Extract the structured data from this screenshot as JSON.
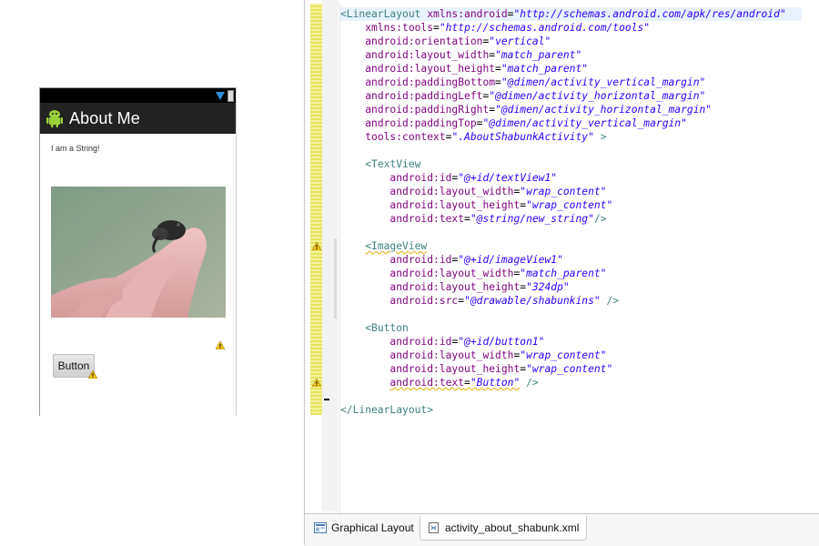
{
  "device": {
    "app_title": "About Me",
    "text_view": "I am a String!",
    "button_label": "Button",
    "icons": [
      "android-icon",
      "wifi-icon",
      "battery-icon",
      "warning-icon"
    ]
  },
  "editor": {
    "lines": [
      {
        "indent": "",
        "parts": [
          [
            "tag",
            "<LinearLayout "
          ],
          [
            "attr",
            "xmlns:android"
          ],
          [
            "eq",
            "="
          ],
          [
            "val",
            "\"http://schemas.android.com/apk/res/android\""
          ]
        ]
      },
      {
        "indent": "    ",
        "parts": [
          [
            "attr",
            "xmlns:tools"
          ],
          [
            "eq",
            "="
          ],
          [
            "val",
            "\"http://schemas.android.com/tools\""
          ]
        ]
      },
      {
        "indent": "    ",
        "parts": [
          [
            "attr",
            "android:orientation"
          ],
          [
            "eq",
            "="
          ],
          [
            "val",
            "\"vertical\""
          ]
        ]
      },
      {
        "indent": "    ",
        "parts": [
          [
            "attr",
            "android:layout_width"
          ],
          [
            "eq",
            "="
          ],
          [
            "val",
            "\"match_parent\""
          ]
        ]
      },
      {
        "indent": "    ",
        "parts": [
          [
            "attr",
            "android:layout_height"
          ],
          [
            "eq",
            "="
          ],
          [
            "val",
            "\"match_parent\""
          ]
        ]
      },
      {
        "indent": "    ",
        "parts": [
          [
            "attr",
            "android:paddingBottom"
          ],
          [
            "eq",
            "="
          ],
          [
            "val",
            "\"@dimen/activity_vertical_margin\""
          ]
        ]
      },
      {
        "indent": "    ",
        "parts": [
          [
            "attr",
            "android:paddingLeft"
          ],
          [
            "eq",
            "="
          ],
          [
            "val",
            "\"@dimen/activity_horizontal_margin\""
          ]
        ]
      },
      {
        "indent": "    ",
        "parts": [
          [
            "attr",
            "android:paddingRight"
          ],
          [
            "eq",
            "="
          ],
          [
            "val",
            "\"@dimen/activity_horizontal_margin\""
          ]
        ]
      },
      {
        "indent": "    ",
        "parts": [
          [
            "attr",
            "android:paddingTop"
          ],
          [
            "eq",
            "="
          ],
          [
            "val",
            "\"@dimen/activity_vertical_margin\""
          ]
        ]
      },
      {
        "indent": "    ",
        "parts": [
          [
            "attr",
            "tools:context"
          ],
          [
            "eq",
            "="
          ],
          [
            "val",
            "\".AboutShabunkActivity\""
          ],
          [
            "tag",
            " >"
          ]
        ]
      },
      {
        "indent": "",
        "parts": []
      },
      {
        "indent": "    ",
        "parts": [
          [
            "tag",
            "<TextView"
          ]
        ]
      },
      {
        "indent": "        ",
        "parts": [
          [
            "attr",
            "android:id"
          ],
          [
            "eq",
            "="
          ],
          [
            "val",
            "\"@+id/textView1\""
          ]
        ]
      },
      {
        "indent": "        ",
        "parts": [
          [
            "attr",
            "android:layout_width"
          ],
          [
            "eq",
            "="
          ],
          [
            "val",
            "\"wrap_content\""
          ]
        ]
      },
      {
        "indent": "        ",
        "parts": [
          [
            "attr",
            "android:layout_height"
          ],
          [
            "eq",
            "="
          ],
          [
            "val",
            "\"wrap_content\""
          ]
        ]
      },
      {
        "indent": "        ",
        "parts": [
          [
            "attr",
            "android:text"
          ],
          [
            "eq",
            "="
          ],
          [
            "val",
            "\"@string/new_string\""
          ],
          [
            "tag",
            "/>"
          ]
        ]
      },
      {
        "indent": "",
        "parts": []
      },
      {
        "indent": "    ",
        "warn": true,
        "parts": [
          [
            "tag squiggle",
            "<ImageView"
          ]
        ]
      },
      {
        "indent": "        ",
        "parts": [
          [
            "attr",
            "android:id"
          ],
          [
            "eq",
            "="
          ],
          [
            "val",
            "\"@+id/imageView1\""
          ]
        ]
      },
      {
        "indent": "        ",
        "parts": [
          [
            "attr",
            "android:layout_width"
          ],
          [
            "eq",
            "="
          ],
          [
            "val",
            "\"match_parent\""
          ]
        ]
      },
      {
        "indent": "        ",
        "parts": [
          [
            "attr",
            "android:layout_height"
          ],
          [
            "eq",
            "="
          ],
          [
            "val",
            "\"324dp\""
          ]
        ]
      },
      {
        "indent": "        ",
        "parts": [
          [
            "attr",
            "android:src"
          ],
          [
            "eq",
            "="
          ],
          [
            "val",
            "\"@drawable/shabunkins\""
          ],
          [
            "tag",
            " />"
          ]
        ]
      },
      {
        "indent": "",
        "parts": []
      },
      {
        "indent": "    ",
        "parts": [
          [
            "tag",
            "<Button"
          ]
        ]
      },
      {
        "indent": "        ",
        "parts": [
          [
            "attr",
            "android:id"
          ],
          [
            "eq",
            "="
          ],
          [
            "val",
            "\"@+id/button1\""
          ]
        ]
      },
      {
        "indent": "        ",
        "parts": [
          [
            "attr",
            "android:layout_width"
          ],
          [
            "eq",
            "="
          ],
          [
            "val",
            "\"wrap_content\""
          ]
        ]
      },
      {
        "indent": "        ",
        "parts": [
          [
            "attr",
            "android:layout_height"
          ],
          [
            "eq",
            "="
          ],
          [
            "val",
            "\"wrap_content\""
          ]
        ]
      },
      {
        "indent": "        ",
        "warn": true,
        "parts": [
          [
            "attr squiggle",
            "android:text"
          ],
          [
            "eq squiggle",
            "="
          ],
          [
            "val squiggle",
            "\"Button\""
          ],
          [
            "tag",
            " />"
          ]
        ]
      },
      {
        "indent": "",
        "parts": []
      },
      {
        "indent": "",
        "parts": [
          [
            "tag",
            "</LinearLayout>"
          ]
        ]
      }
    ]
  },
  "tabs": {
    "graphical": "Graphical Layout",
    "xml": "activity_about_shabunk.xml"
  }
}
